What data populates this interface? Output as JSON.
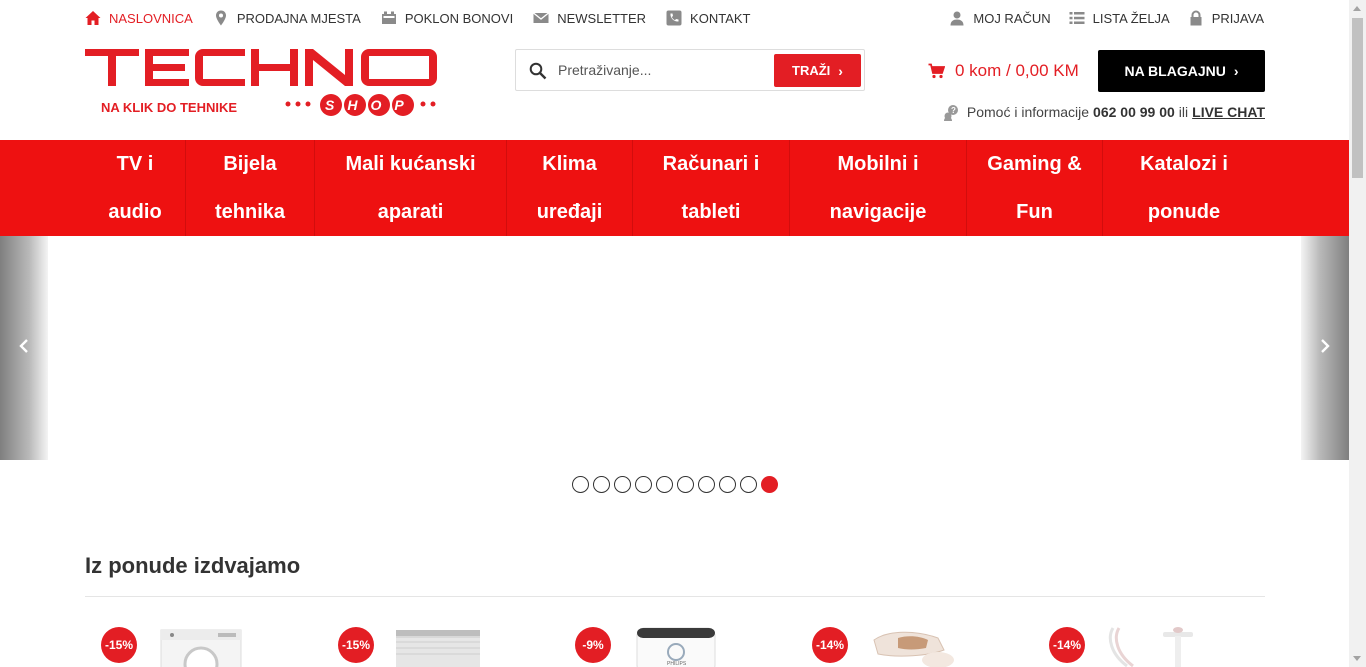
{
  "colors": {
    "brand_red": "#e31e24",
    "nav_red": "#ee1111",
    "black": "#000000"
  },
  "topbar": {
    "left": [
      {
        "label": "NASLOVNICA",
        "icon": "home-icon",
        "active": true
      },
      {
        "label": "PRODAJNA MJESTA",
        "icon": "map-pin-icon"
      },
      {
        "label": "POKLON BONOVI",
        "icon": "gift-card-icon"
      },
      {
        "label": "NEWSLETTER",
        "icon": "envelope-icon"
      },
      {
        "label": "KONTAKT",
        "icon": "phone-icon"
      }
    ],
    "right": [
      {
        "label": "MOJ RAČUN",
        "icon": "user-icon"
      },
      {
        "label": "LISTA ŽELJA",
        "icon": "list-icon"
      },
      {
        "label": "PRIJAVA",
        "icon": "lock-icon"
      }
    ]
  },
  "logo": {
    "word": "TECHNO",
    "sub": "SHOP",
    "tagline": "NA KLIK DO TEHNIKE"
  },
  "search": {
    "placeholder": "Pretraživanje...",
    "value": "",
    "button": "TRAŽI",
    "icon": "search-icon"
  },
  "cart": {
    "label": "0 kom / 0,00 KM",
    "icon": "cart-icon"
  },
  "checkout": {
    "label": "NA BLAGAJNU",
    "icon": "chevron-right-icon"
  },
  "help": {
    "text": "Pomoć i informacije",
    "phone": "062 00 99 00",
    "or": "ili",
    "live_chat": "LIVE CHAT",
    "icon": "help-icon"
  },
  "nav": [
    {
      "line1": "TV i",
      "line2": "audio"
    },
    {
      "line1": "Bijela",
      "line2": "tehnika"
    },
    {
      "line1": "Mali kućanski",
      "line2": "aparati"
    },
    {
      "line1": "Klima",
      "line2": "uređaji"
    },
    {
      "line1": "Računari i",
      "line2": "tableti"
    },
    {
      "line1": "Mobilni i",
      "line2": "navigacije"
    },
    {
      "line1": "Gaming &",
      "line2": "Fun"
    },
    {
      "line1": "Katalozi i",
      "line2": "ponude"
    }
  ],
  "slider": {
    "dot_count": 10,
    "active_dot": 10,
    "prev_icon": "chevron-left-icon",
    "next_icon": "chevron-right-icon"
  },
  "featured": {
    "title": "Iz ponude izdvajamo",
    "products": [
      {
        "discount": "-15%",
        "image": "washing-machine-image"
      },
      {
        "discount": "-15%",
        "image": "dishwasher-image"
      },
      {
        "discount": "-9%",
        "image": "air-purifier-image"
      },
      {
        "discount": "-14%",
        "image": "ipl-epilator-image"
      },
      {
        "discount": "-14%",
        "image": "garment-steamer-image"
      }
    ]
  }
}
